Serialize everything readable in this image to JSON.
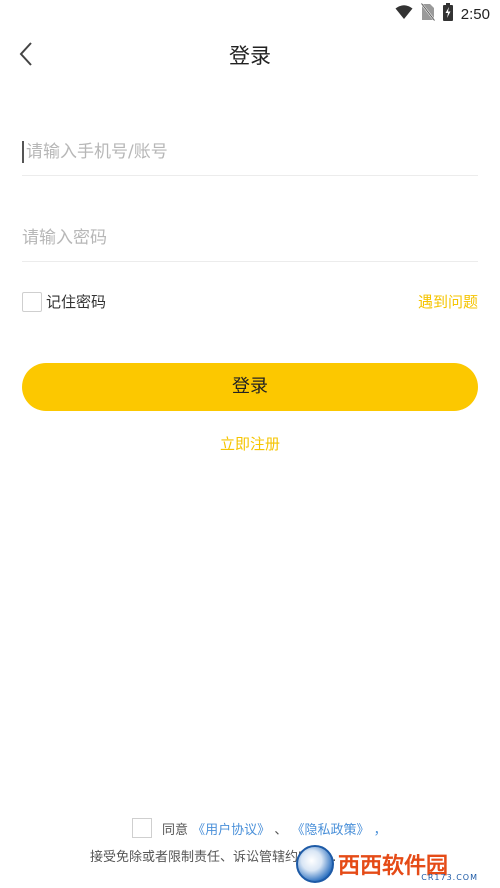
{
  "status_bar": {
    "time": "2:50",
    "icons": [
      "wifi-icon",
      "no-sim-icon",
      "battery-charging-icon"
    ]
  },
  "header": {
    "title": "登录",
    "back_icon": "chevron-left-icon"
  },
  "form": {
    "phone_placeholder": "请输入手机号/账号",
    "phone_value": "",
    "password_placeholder": "请输入密码",
    "password_value": "",
    "remember_label": "记住密码",
    "remember_checked": false,
    "problem_link": "遇到问题",
    "login_button": "登录",
    "register_link": "立即注册"
  },
  "agreement": {
    "checked": false,
    "prefix": "同意",
    "user_agreement": "《用户协议》",
    "separator": "、",
    "privacy_policy": "《隐私政策》",
    "suffix": "，",
    "line2": "接受免除或者限制责任、诉讼管辖约定等..."
  },
  "watermark": {
    "text": "西西软件园",
    "sub": "CR173.COM"
  },
  "colors": {
    "accent": "#fcc800",
    "link_yellow": "#f5c400",
    "link_blue": "#4a90d9"
  }
}
